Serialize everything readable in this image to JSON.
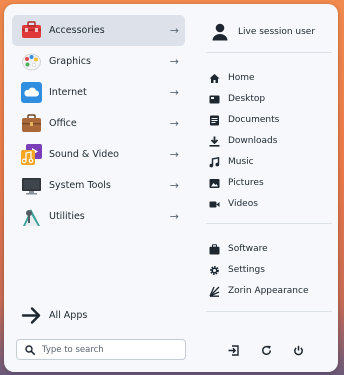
{
  "categories": [
    {
      "label": "Accessories",
      "icon": "toolbox-icon",
      "active": true
    },
    {
      "label": "Graphics",
      "icon": "palette-icon"
    },
    {
      "label": "Internet",
      "icon": "cloud-icon"
    },
    {
      "label": "Office",
      "icon": "briefcase-icon"
    },
    {
      "label": "Sound & Video",
      "icon": "music-video-icon"
    },
    {
      "label": "System Tools",
      "icon": "monitor-icon"
    },
    {
      "label": "Utilities",
      "icon": "utilities-icon"
    }
  ],
  "all_apps": {
    "label": "All Apps"
  },
  "search": {
    "placeholder": "Type to search"
  },
  "user": {
    "name": "Live session user"
  },
  "places": [
    {
      "label": "Home",
      "icon": "home-icon"
    },
    {
      "label": "Desktop",
      "icon": "desktop-icon"
    },
    {
      "label": "Documents",
      "icon": "document-icon"
    },
    {
      "label": "Downloads",
      "icon": "download-icon"
    },
    {
      "label": "Music",
      "icon": "music-icon"
    },
    {
      "label": "Pictures",
      "icon": "picture-icon"
    },
    {
      "label": "Videos",
      "icon": "video-icon"
    }
  ],
  "system": [
    {
      "label": "Software",
      "icon": "software-icon"
    },
    {
      "label": "Settings",
      "icon": "gear-icon"
    },
    {
      "label": "Zorin Appearance",
      "icon": "appearance-icon"
    }
  ],
  "power": [
    {
      "name": "logout-icon"
    },
    {
      "name": "restart-icon"
    },
    {
      "name": "power-icon"
    }
  ],
  "colors": {
    "accent_active": "#dde2ea",
    "text": "#1e2730"
  }
}
